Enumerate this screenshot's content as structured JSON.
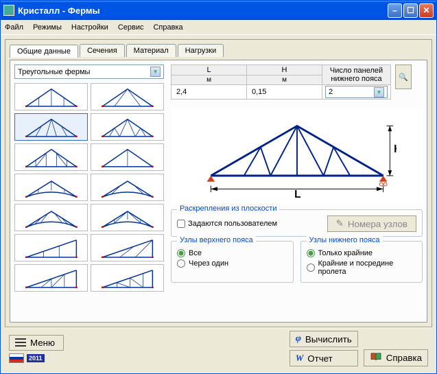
{
  "window_title": "Кристалл - Фермы",
  "menus": {
    "file": "Файл",
    "modes": "Режимы",
    "settings": "Настройки",
    "service": "Сервис",
    "help": "Справка"
  },
  "tabs": {
    "general": "Общие данные",
    "sections": "Сечения",
    "material": "Материал",
    "loads": "Нагрузки"
  },
  "truss_type_combo": "Треугольные фермы",
  "params": {
    "L_label": "L",
    "L_unit": "м",
    "L_value": "2,4",
    "H_label": "H",
    "H_unit": "м",
    "H_value": "0,15",
    "panels_label_line1": "Число панелей",
    "panels_label_line2": "нижнего пояса",
    "panels_value": "2"
  },
  "bracing": {
    "group_title": "Раскрепления из плоскости",
    "user_defined": "Задаются пользователем",
    "nodes_btn": "Номера узлов"
  },
  "upper": {
    "title": "Узлы верхнего пояса",
    "all": "Все",
    "every_other": "Через один"
  },
  "lower": {
    "title": "Узлы нижнего пояса",
    "edge_only": "Только крайние",
    "edge_mid": "Крайние и посредине пролета"
  },
  "footer": {
    "menu": "Меню",
    "calc": "Вычислить",
    "report": "Отчет",
    "help": "Справка",
    "year": "2011"
  },
  "truss_icons": [
    "triangle1",
    "triangle2",
    "triangle3",
    "triangle4",
    "triangle5",
    "triangle6",
    "triangle7",
    "triangle8",
    "triangle9",
    "triangle10",
    "triangle11",
    "triangle12",
    "triangle13",
    "triangle14"
  ]
}
